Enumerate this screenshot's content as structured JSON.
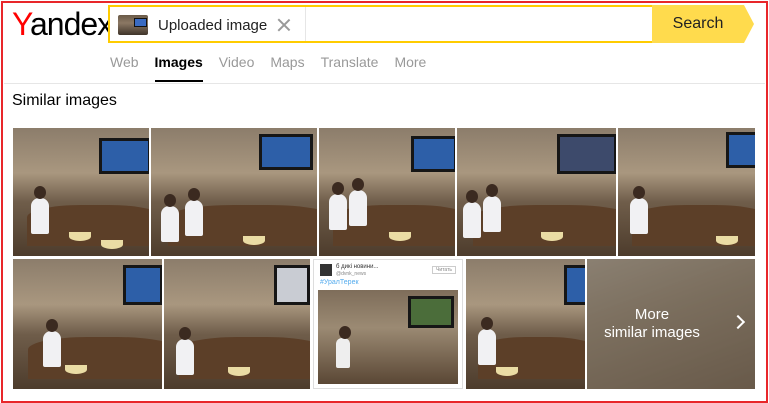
{
  "logo": {
    "first_letter": "Y",
    "rest": "andex"
  },
  "search": {
    "query_label": "Uploaded image",
    "button_label": "Search",
    "thumbnail_icon": "uploaded-image-thumbnail",
    "clear_icon": "close-icon"
  },
  "tabs": [
    {
      "label": "Web",
      "active": false
    },
    {
      "label": "Images",
      "active": true
    },
    {
      "label": "Video",
      "active": false
    },
    {
      "label": "Maps",
      "active": false
    },
    {
      "label": "Translate",
      "active": false
    },
    {
      "label": "More",
      "active": false
    }
  ],
  "section": {
    "title": "Similar images"
  },
  "results": {
    "doc_tile": {
      "account_name": "б дикі новини...",
      "account_sub": "@dvnk_news",
      "follow_label": "Читать",
      "hashtag": "#УралТерек"
    },
    "more_tile": {
      "line1": "More",
      "line2": "similar images",
      "icon": "chevron-right-icon"
    }
  },
  "colors": {
    "accent": "#ffdb4d",
    "frame": "#e8262a",
    "logo_red": "#ff0000"
  }
}
